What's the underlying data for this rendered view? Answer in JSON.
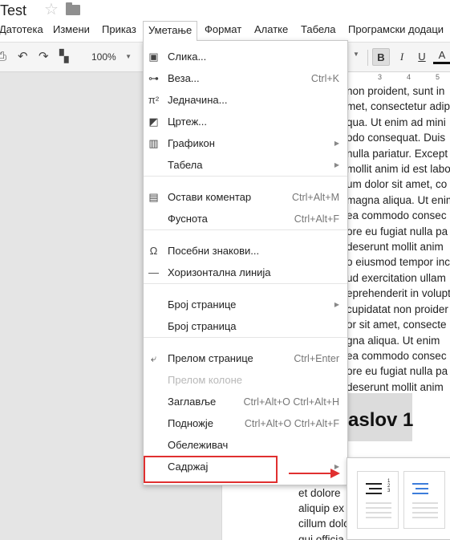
{
  "document": {
    "title": "Test"
  },
  "menubar": [
    "Датотека",
    "Измени",
    "Приказ",
    "Уметање",
    "Формат",
    "Алатке",
    "Табела",
    "Програмски додаци"
  ],
  "toolbar": {
    "zoom": "100%",
    "bold": "B",
    "italic": "I",
    "underline": "U",
    "text_color": "A"
  },
  "ruler": [
    "3",
    "4",
    "5"
  ],
  "insert_menu": [
    {
      "label": "Слика...",
      "icon": "image-icon"
    },
    {
      "label": "Веза...",
      "shortcut": "Ctrl+K",
      "icon": "link-icon"
    },
    {
      "label": "Једначина...",
      "icon": "equation-icon"
    },
    {
      "label": "Цртеж...",
      "icon": "drawing-icon"
    },
    {
      "label": "Графикон",
      "icon": "chart-icon",
      "submenu": true
    },
    {
      "label": "Табела",
      "submenu": true
    },
    {
      "label": "Остави коментар",
      "shortcut": "Ctrl+Alt+M",
      "icon": "comment-icon"
    },
    {
      "label": "Фуснота",
      "shortcut": "Ctrl+Alt+F"
    },
    {
      "label": "Посебни знакови...",
      "icon": "omega-icon"
    },
    {
      "label": "Хоризонтална линија",
      "icon": "horizontal-line-icon"
    },
    {
      "label": "Број странице",
      "submenu": true
    },
    {
      "label": "Број страница"
    },
    {
      "label": "Прелом странице",
      "shortcut": "Ctrl+Enter",
      "icon": "page-break-icon"
    },
    {
      "label": "Прелом колоне",
      "disabled": true
    },
    {
      "label": "Заглавље",
      "shortcut": "Ctrl+Alt+O Ctrl+Alt+H"
    },
    {
      "label": "Подножје",
      "shortcut": "Ctrl+Alt+O Ctrl+Alt+F"
    },
    {
      "label": "Обележивач"
    },
    {
      "label": "Садржај",
      "submenu": true,
      "hovered": true
    }
  ],
  "doc_text": [
    "non proident, sunt in",
    "met, consectetur adip",
    "qua. Ut enim ad mini",
    "odo consequat. Duis",
    "nulla pariatur. Except",
    "mollit anim id est labo",
    "um dolor sit amet, co",
    "magna aliqua. Ut enim",
    "ea commodo consec",
    "ore eu fugiat nulla pa",
    "deserunt mollit anim",
    "o eiusmod tempor inc",
    "ud exercitation ullam",
    "eprehenderit in volupt",
    "cupidatat non proider",
    "or sit amet, consecte",
    "gna aliqua. Ut enim",
    "ea commodo consec",
    "ore eu fugiat nulla pa",
    "deserunt mollit anim"
  ],
  "heading": "aslov 1",
  "lower_text": [
    "et dolore",
    "aliquip ex",
    "cillum dolo",
    "qui officia"
  ],
  "colors": {
    "highlight": "#e03030",
    "toc_blue": "#3d7ddb"
  }
}
